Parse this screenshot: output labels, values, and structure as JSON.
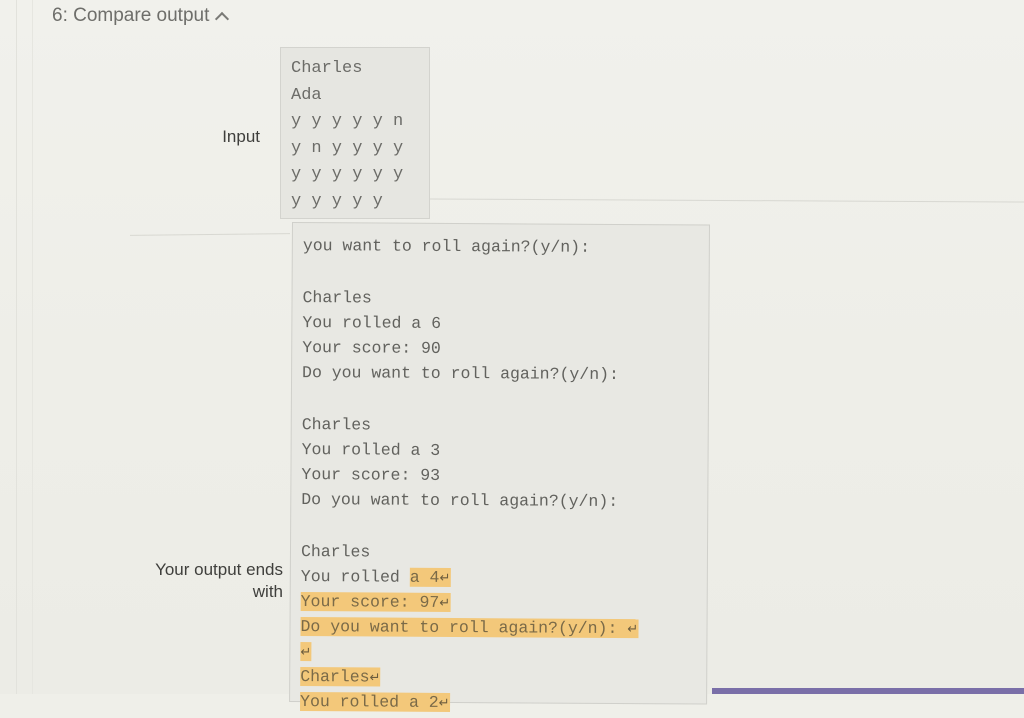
{
  "section": {
    "title": "6: Compare output",
    "toggle_icon": "chevron-up-icon"
  },
  "input": {
    "label": "Input",
    "lines": [
      "Charles",
      "Ada",
      "y y y y y n",
      "y n y y y y",
      "y y y y y y",
      "y y y y y"
    ]
  },
  "output": {
    "label": "Your output ends with",
    "label_line1": "Your output ends",
    "label_line2": "with",
    "lines": [
      {
        "text": "you want to roll again?(y/n):",
        "highlight": "",
        "ret": false
      },
      {
        "text": "",
        "highlight": "",
        "ret": false
      },
      {
        "text": "Charles",
        "highlight": "",
        "ret": false
      },
      {
        "text": "You rolled a 6",
        "highlight": "",
        "ret": false
      },
      {
        "text": "Your score: 90",
        "highlight": "",
        "ret": false
      },
      {
        "text": "Do you want to roll again?(y/n):",
        "highlight": "",
        "ret": false
      },
      {
        "text": "",
        "highlight": "",
        "ret": false
      },
      {
        "text": "Charles",
        "highlight": "",
        "ret": false
      },
      {
        "text": "You rolled a 3",
        "highlight": "",
        "ret": false
      },
      {
        "text": "Your score: 93",
        "highlight": "",
        "ret": false
      },
      {
        "text": "Do you want to roll again?(y/n):",
        "highlight": "",
        "ret": false
      },
      {
        "text": "",
        "highlight": "",
        "ret": false
      },
      {
        "text": "Charles",
        "highlight": "",
        "ret": false
      },
      {
        "text": "You rolled ",
        "highlight": "a 4",
        "ret": true
      },
      {
        "text": "",
        "highlight": "Your score: 97",
        "ret": true
      },
      {
        "text": "",
        "highlight": "Do you want to roll again?(y/n): ",
        "ret": true
      },
      {
        "text": "",
        "highlight": "",
        "ret": true,
        "highlight_ret_only": true
      },
      {
        "text": "",
        "highlight": "Charles",
        "ret": true
      },
      {
        "text": "",
        "highlight": "You rolled a 2",
        "ret": true
      }
    ],
    "return_symbol": "↵",
    "highlight_color": "#f3c87a"
  }
}
